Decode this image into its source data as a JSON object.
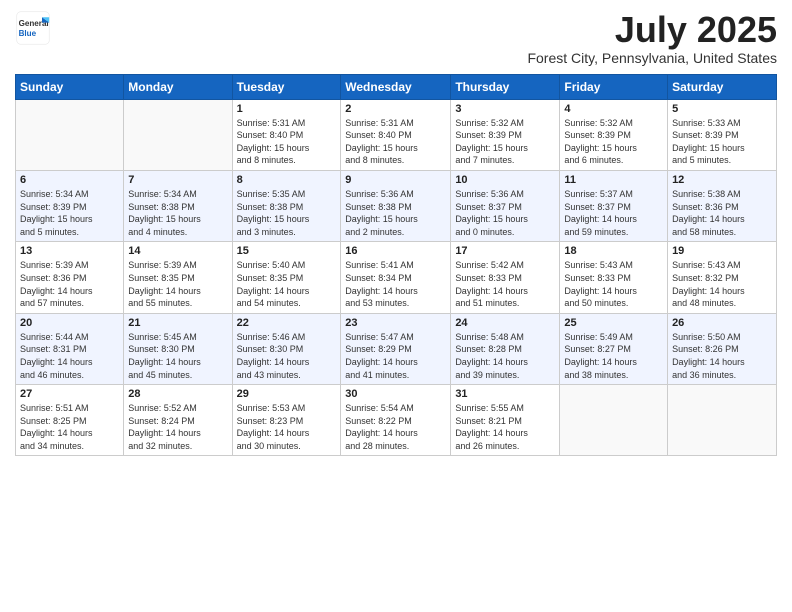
{
  "header": {
    "logo": {
      "general": "General",
      "blue": "Blue"
    },
    "title": "July 2025",
    "location": "Forest City, Pennsylvania, United States"
  },
  "weekdays": [
    "Sunday",
    "Monday",
    "Tuesday",
    "Wednesday",
    "Thursday",
    "Friday",
    "Saturday"
  ],
  "weeks": [
    [
      {
        "day": "",
        "info": ""
      },
      {
        "day": "",
        "info": ""
      },
      {
        "day": "1",
        "info": "Sunrise: 5:31 AM\nSunset: 8:40 PM\nDaylight: 15 hours\nand 8 minutes."
      },
      {
        "day": "2",
        "info": "Sunrise: 5:31 AM\nSunset: 8:40 PM\nDaylight: 15 hours\nand 8 minutes."
      },
      {
        "day": "3",
        "info": "Sunrise: 5:32 AM\nSunset: 8:39 PM\nDaylight: 15 hours\nand 7 minutes."
      },
      {
        "day": "4",
        "info": "Sunrise: 5:32 AM\nSunset: 8:39 PM\nDaylight: 15 hours\nand 6 minutes."
      },
      {
        "day": "5",
        "info": "Sunrise: 5:33 AM\nSunset: 8:39 PM\nDaylight: 15 hours\nand 5 minutes."
      }
    ],
    [
      {
        "day": "6",
        "info": "Sunrise: 5:34 AM\nSunset: 8:39 PM\nDaylight: 15 hours\nand 5 minutes."
      },
      {
        "day": "7",
        "info": "Sunrise: 5:34 AM\nSunset: 8:38 PM\nDaylight: 15 hours\nand 4 minutes."
      },
      {
        "day": "8",
        "info": "Sunrise: 5:35 AM\nSunset: 8:38 PM\nDaylight: 15 hours\nand 3 minutes."
      },
      {
        "day": "9",
        "info": "Sunrise: 5:36 AM\nSunset: 8:38 PM\nDaylight: 15 hours\nand 2 minutes."
      },
      {
        "day": "10",
        "info": "Sunrise: 5:36 AM\nSunset: 8:37 PM\nDaylight: 15 hours\nand 0 minutes."
      },
      {
        "day": "11",
        "info": "Sunrise: 5:37 AM\nSunset: 8:37 PM\nDaylight: 14 hours\nand 59 minutes."
      },
      {
        "day": "12",
        "info": "Sunrise: 5:38 AM\nSunset: 8:36 PM\nDaylight: 14 hours\nand 58 minutes."
      }
    ],
    [
      {
        "day": "13",
        "info": "Sunrise: 5:39 AM\nSunset: 8:36 PM\nDaylight: 14 hours\nand 57 minutes."
      },
      {
        "day": "14",
        "info": "Sunrise: 5:39 AM\nSunset: 8:35 PM\nDaylight: 14 hours\nand 55 minutes."
      },
      {
        "day": "15",
        "info": "Sunrise: 5:40 AM\nSunset: 8:35 PM\nDaylight: 14 hours\nand 54 minutes."
      },
      {
        "day": "16",
        "info": "Sunrise: 5:41 AM\nSunset: 8:34 PM\nDaylight: 14 hours\nand 53 minutes."
      },
      {
        "day": "17",
        "info": "Sunrise: 5:42 AM\nSunset: 8:33 PM\nDaylight: 14 hours\nand 51 minutes."
      },
      {
        "day": "18",
        "info": "Sunrise: 5:43 AM\nSunset: 8:33 PM\nDaylight: 14 hours\nand 50 minutes."
      },
      {
        "day": "19",
        "info": "Sunrise: 5:43 AM\nSunset: 8:32 PM\nDaylight: 14 hours\nand 48 minutes."
      }
    ],
    [
      {
        "day": "20",
        "info": "Sunrise: 5:44 AM\nSunset: 8:31 PM\nDaylight: 14 hours\nand 46 minutes."
      },
      {
        "day": "21",
        "info": "Sunrise: 5:45 AM\nSunset: 8:30 PM\nDaylight: 14 hours\nand 45 minutes."
      },
      {
        "day": "22",
        "info": "Sunrise: 5:46 AM\nSunset: 8:30 PM\nDaylight: 14 hours\nand 43 minutes."
      },
      {
        "day": "23",
        "info": "Sunrise: 5:47 AM\nSunset: 8:29 PM\nDaylight: 14 hours\nand 41 minutes."
      },
      {
        "day": "24",
        "info": "Sunrise: 5:48 AM\nSunset: 8:28 PM\nDaylight: 14 hours\nand 39 minutes."
      },
      {
        "day": "25",
        "info": "Sunrise: 5:49 AM\nSunset: 8:27 PM\nDaylight: 14 hours\nand 38 minutes."
      },
      {
        "day": "26",
        "info": "Sunrise: 5:50 AM\nSunset: 8:26 PM\nDaylight: 14 hours\nand 36 minutes."
      }
    ],
    [
      {
        "day": "27",
        "info": "Sunrise: 5:51 AM\nSunset: 8:25 PM\nDaylight: 14 hours\nand 34 minutes."
      },
      {
        "day": "28",
        "info": "Sunrise: 5:52 AM\nSunset: 8:24 PM\nDaylight: 14 hours\nand 32 minutes."
      },
      {
        "day": "29",
        "info": "Sunrise: 5:53 AM\nSunset: 8:23 PM\nDaylight: 14 hours\nand 30 minutes."
      },
      {
        "day": "30",
        "info": "Sunrise: 5:54 AM\nSunset: 8:22 PM\nDaylight: 14 hours\nand 28 minutes."
      },
      {
        "day": "31",
        "info": "Sunrise: 5:55 AM\nSunset: 8:21 PM\nDaylight: 14 hours\nand 26 minutes."
      },
      {
        "day": "",
        "info": ""
      },
      {
        "day": "",
        "info": ""
      }
    ]
  ]
}
